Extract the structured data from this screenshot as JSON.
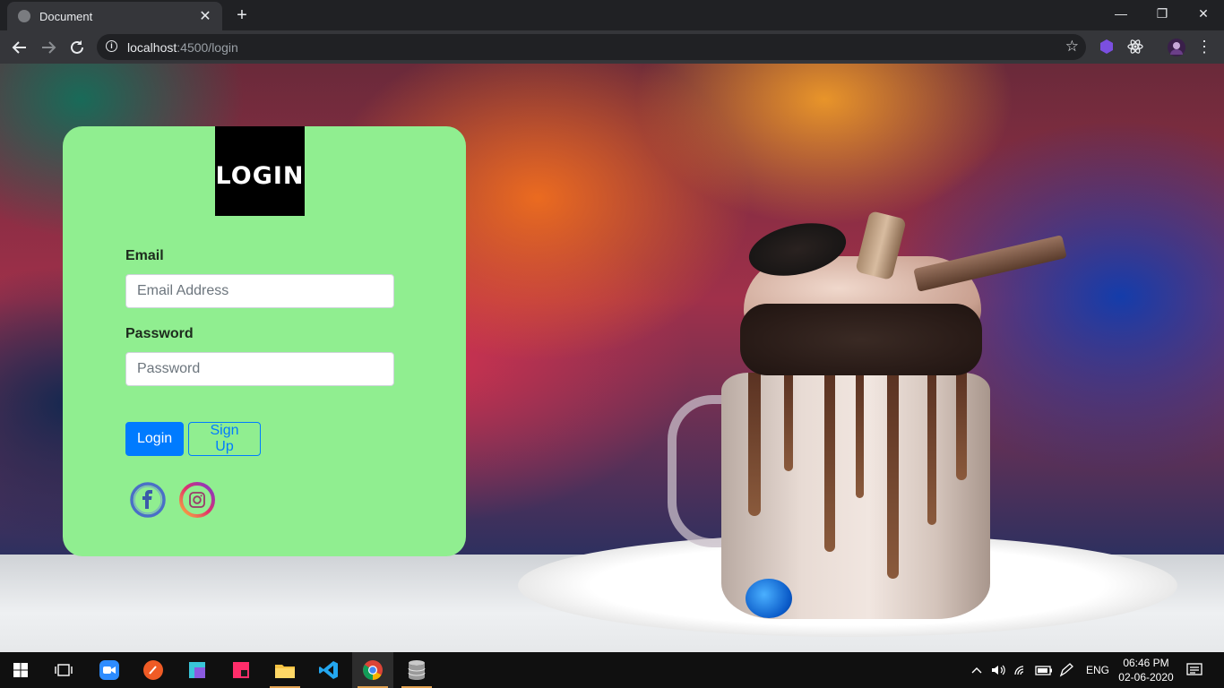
{
  "browser": {
    "tab_title": "Document",
    "tab_close": "✕",
    "new_tab": "+",
    "url_host": "localhost",
    "url_rest": ":4500/login",
    "window_controls": {
      "minimize": "—",
      "restore": "❐",
      "close": "✕"
    }
  },
  "login_card": {
    "logo_text": "LOGIN",
    "email_label": "Email",
    "email_placeholder": "Email Address",
    "email_value": "",
    "password_label": "Password",
    "password_placeholder": "Password",
    "password_value": "",
    "login_button": "Login",
    "signup_button": "Sign Up",
    "social_icons": [
      "facebook-icon",
      "instagram-icon"
    ],
    "colors": {
      "card": "#90ee90",
      "primary": "#007bff",
      "logo_bg": "#000000"
    }
  },
  "taskbar": {
    "apps": [
      "start-icon",
      "task-view-icon",
      "zoom-icon",
      "postman-icon",
      "app-icon",
      "app-icon-2",
      "file-explorer-icon",
      "vscode-icon",
      "chrome-icon",
      "database-icon"
    ],
    "language": "ENG",
    "time": "06:46 PM",
    "date": "02-06-2020"
  }
}
